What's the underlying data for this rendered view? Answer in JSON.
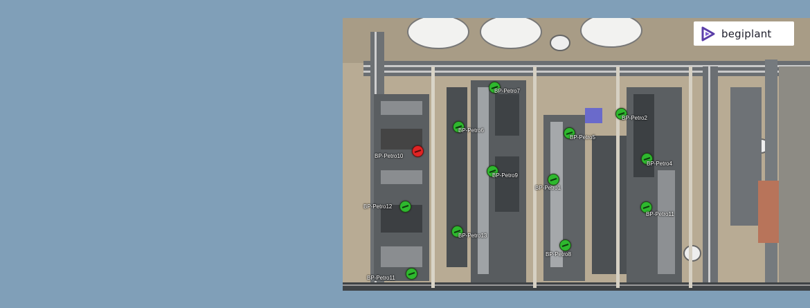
{
  "brand": {
    "name": "begiplant",
    "icon": "play-triangle-logo",
    "accent": "#5b3ea8"
  },
  "colors": {
    "background": "#809fb8",
    "status_ok": "#2eb82e",
    "status_alarm": "#e02424"
  },
  "markers": [
    {
      "label": "BP-Petro7",
      "status": "ok"
    },
    {
      "label": "BP-Petro2",
      "status": "ok"
    },
    {
      "label": "BP-Petro6",
      "status": "ok"
    },
    {
      "label": "BP-Petro5",
      "status": "ok"
    },
    {
      "label": "BP-Petro10",
      "status": "alarm"
    },
    {
      "label": "BP-Petro9",
      "status": "ok"
    },
    {
      "label": "BP-Petro4",
      "status": "ok"
    },
    {
      "label": "BP-Petro1",
      "status": "ok"
    },
    {
      "label": "BP-Petro12",
      "status": "ok"
    },
    {
      "label": "BP-Petro11",
      "status": "ok"
    },
    {
      "label": "BP-Petro13",
      "status": "ok"
    },
    {
      "label": "BP-Petro8",
      "status": "ok"
    },
    {
      "label": "BP-Petro11",
      "status": "ok"
    }
  ]
}
